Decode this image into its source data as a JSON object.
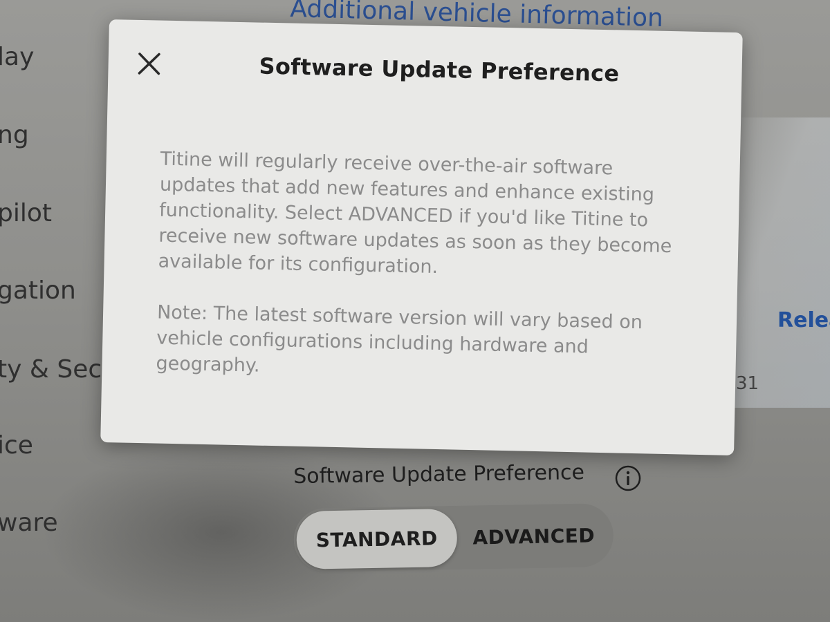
{
  "background": {
    "top_link": "Additional vehicle information",
    "sidebar_items": [
      {
        "label": "lay"
      },
      {
        "label": "ng"
      },
      {
        "label": "pilot"
      },
      {
        "label": "gation"
      },
      {
        "label": "ty & Secu"
      },
      {
        "label": "ice"
      },
      {
        "label": "ware"
      }
    ],
    "right_link": "Relea",
    "right_fragment": "31"
  },
  "modal": {
    "title": "Software Update Preference",
    "close_icon": "close-icon",
    "paragraphs": [
      "Titine will regularly receive over-the-air software updates that add new features and enhance existing functionality. Select ADVANCED if you'd like Titine to receive new software updates as soon as they become available for its configuration.",
      "Note: The latest software version will vary based on vehicle configurations including hardware and geography."
    ]
  },
  "setting": {
    "label": "Software Update Preference",
    "info_icon": "info-icon",
    "options": [
      {
        "label": "STANDARD",
        "selected": true
      },
      {
        "label": "ADVANCED",
        "selected": false
      }
    ]
  },
  "colors": {
    "modal_background": "#e9e9e7",
    "link_blue": "#2b4f91",
    "body_text": "#8b8b8b",
    "selected_segment": "#c4c4c1"
  }
}
